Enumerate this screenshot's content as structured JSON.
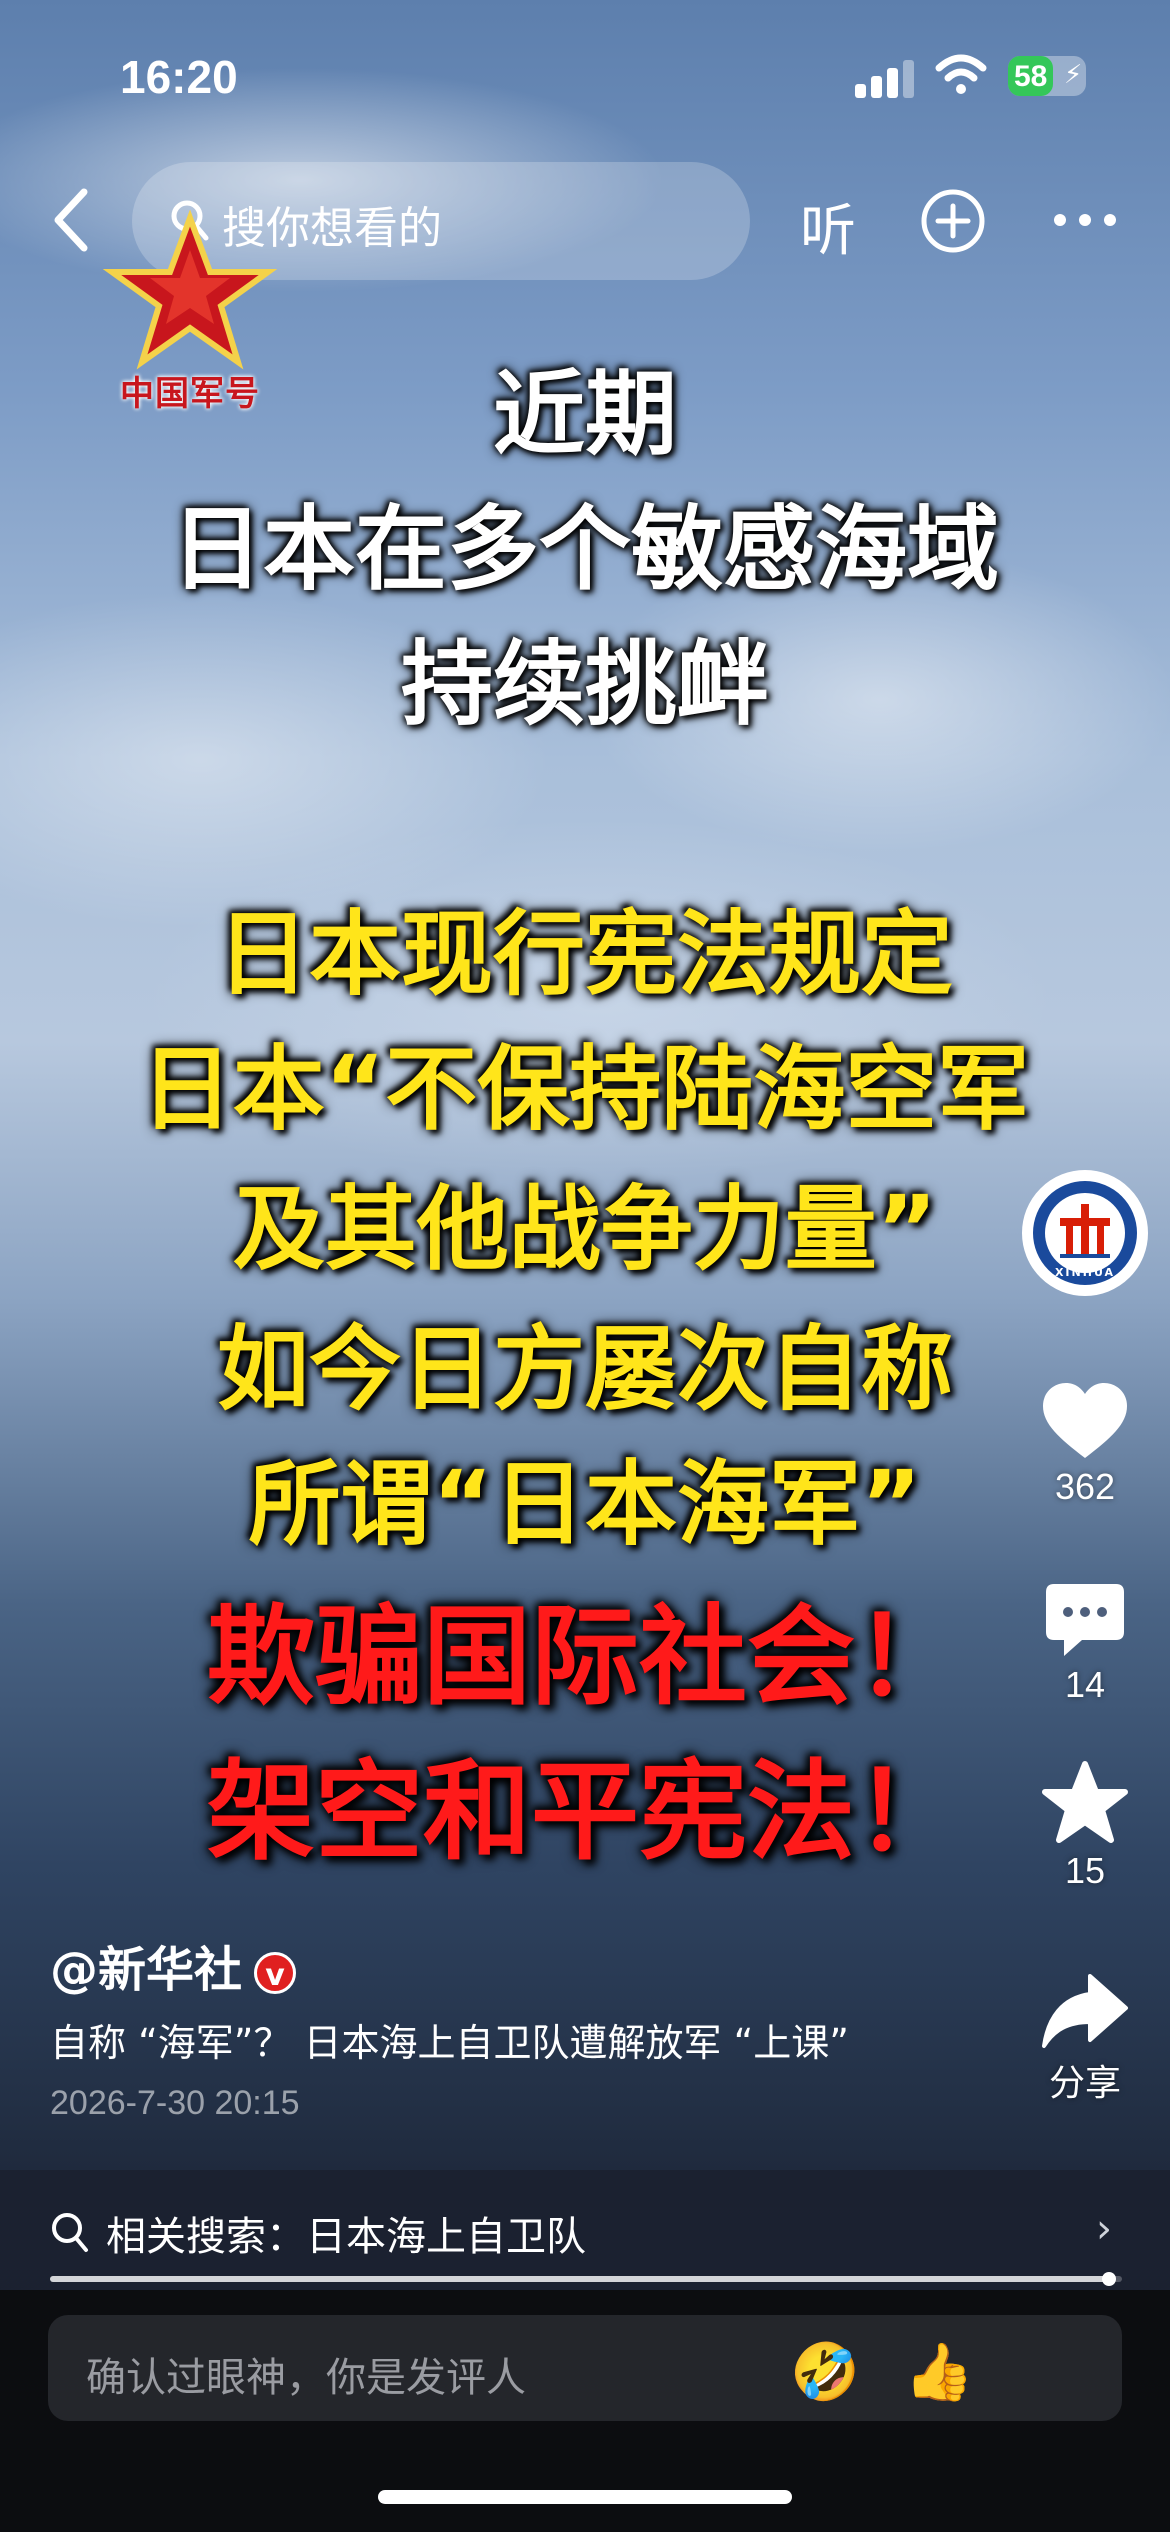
{
  "status_bar": {
    "time": "16:20",
    "battery": "58",
    "battery_level": 0.58
  },
  "nav": {
    "search_placeholder": "搜你想看的",
    "listen_label": "听"
  },
  "logo": {
    "text": "中国军号"
  },
  "headline": {
    "white_lines": [
      "近期",
      "日本在多个敏感海域",
      "持续挑衅"
    ],
    "yellow_lines": [
      "日本现行宪法规定",
      "日本“不保持陆海空军",
      "及其他战争力量”",
      "如今日方屡次自称",
      "所谓“日本海军”"
    ],
    "red_lines": [
      "欺骗国际社会！",
      "架空和平宪法！"
    ]
  },
  "actions": {
    "avatar_text": "XINHUA",
    "like_count": "362",
    "comment_count": "14",
    "favorite_count": "15",
    "share_label": "分享"
  },
  "post": {
    "author": "@新华社",
    "verified": "v",
    "caption": "自称 “海军”？ 日本海上自卫队遭解放军 “上课”",
    "date": "2026-7-30 20:15"
  },
  "related": {
    "label": "相关搜索：日本海上自卫队",
    "chevron": "›"
  },
  "progress": {
    "value": 0.988
  },
  "comment": {
    "placeholder": "确认过眼神，你是发评人",
    "emoji_1": "🤣",
    "emoji_2": "👍"
  },
  "colors": {
    "headline_yellow": "#ffe51a",
    "headline_red": "#ff1a1a",
    "verified_red": "#e02020",
    "battery_green": "#34c759"
  }
}
